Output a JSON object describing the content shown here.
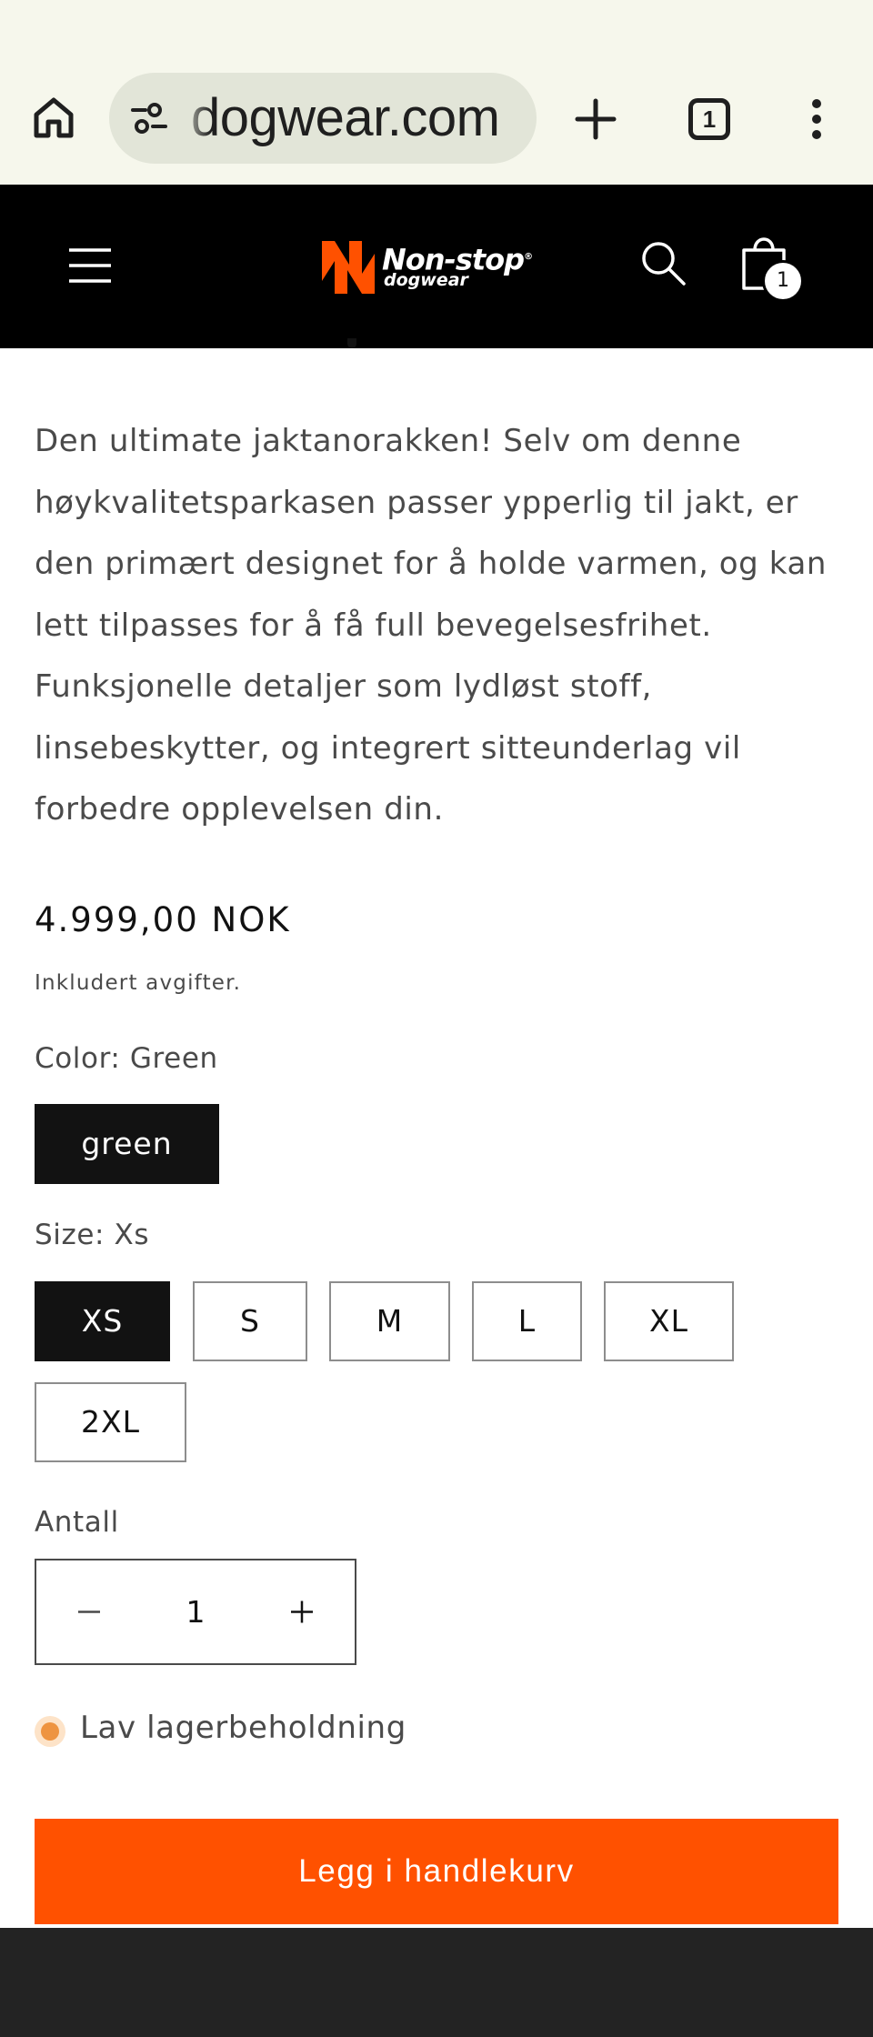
{
  "browser": {
    "url": "dogwear.com",
    "tab_count": "1",
    "icons": [
      "home-icon",
      "site-settings-icon",
      "new-tab-icon",
      "tab-switcher-icon",
      "more-menu-icon"
    ]
  },
  "header": {
    "logo_text": "Non-stop",
    "logo_sub": "dogwear",
    "logo_reg": "®",
    "cart_count": "1",
    "background": "#000000",
    "icons": [
      "menu-icon",
      "search-icon",
      "cart-icon"
    ]
  },
  "product": {
    "description": "Den ultimate jaktanorakken! Selv om denne høykvalitetsparkasen passer ypperlig til jakt, er den primært designet for å holde varmen, og kan lett tilpasses for å få full bevegelsesfrihet. Funksjonelle detaljer som lydløst stoff, linsebeskytter, og integrert sitteunderlag vil forbedre opplevelsen din.",
    "price": "4.999,00 NOK",
    "tax_note": "Inkludert avgifter.",
    "color": {
      "label": "Color: Green",
      "options": [
        "green"
      ],
      "selected": "green"
    },
    "size": {
      "label": "Size: Xs",
      "options": [
        "XS",
        "S",
        "M",
        "L",
        "XL",
        "2XL"
      ],
      "selected": "XS"
    },
    "quantity": {
      "label": "Antall",
      "value": "1"
    },
    "stock_status": "Lav lagerbeholdning",
    "stock_color": "#ee9441",
    "add_to_cart_label": "Legg i handlekurv",
    "accent_color": "#ff5100"
  }
}
